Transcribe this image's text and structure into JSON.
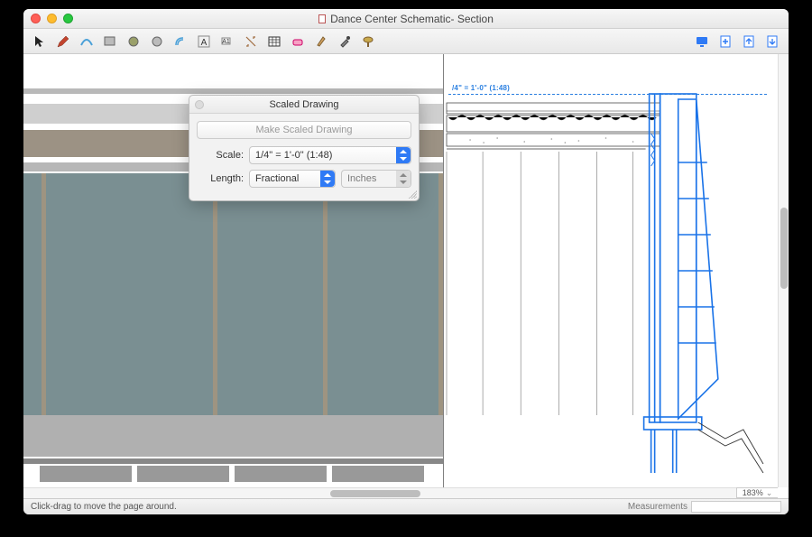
{
  "window": {
    "title": "Dance Center Schematic- Section"
  },
  "toolbar": {
    "icons": [
      "select",
      "pencil",
      "arc",
      "rect",
      "polygon",
      "circle",
      "offset",
      "text-a",
      "text-box",
      "dims",
      "table",
      "eraser",
      "eyedropper",
      "brush",
      "paint"
    ],
    "right_icons": [
      "display",
      "add-page",
      "import",
      "export"
    ]
  },
  "dialog": {
    "title": "Scaled Drawing",
    "make_button": "Make Scaled Drawing",
    "scale_label": "Scale:",
    "scale_value": "1/4\" = 1'-0\" (1:48)",
    "length_label": "Length:",
    "length_value": "Fractional",
    "length_unit": "Inches"
  },
  "canvas": {
    "scale_note": "/4\" = 1'-0\" (1:48)"
  },
  "zoom": {
    "value": "183%"
  },
  "status": {
    "hint": "Click-drag to move the page around.",
    "meas_label": "Measurements"
  }
}
